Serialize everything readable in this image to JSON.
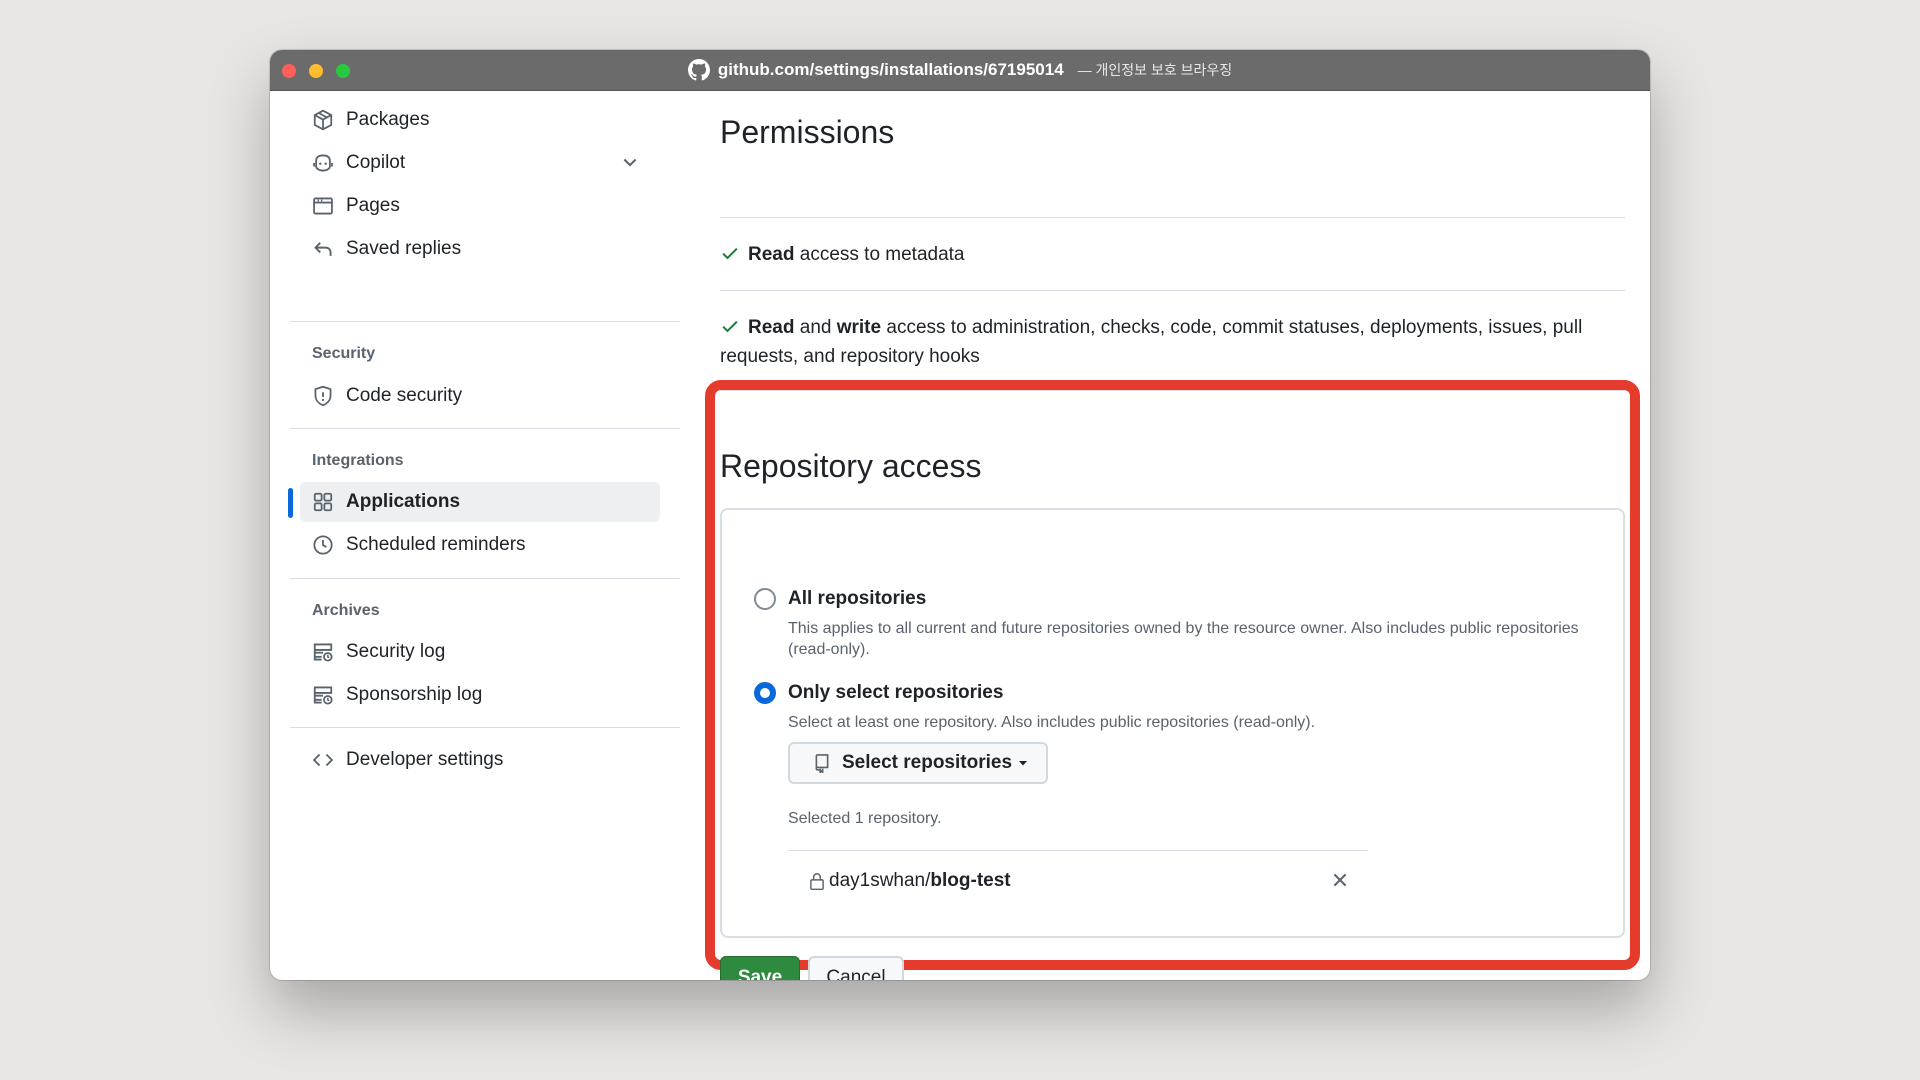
{
  "browser": {
    "url": "github.com/settings/installations/67195014",
    "title_suffix": "— 개인정보 보호 브라우징"
  },
  "sidebar": {
    "items_top": [
      {
        "label": "Packages",
        "icon": "package-icon"
      },
      {
        "label": "Copilot",
        "icon": "copilot-icon",
        "has_chevron": true
      },
      {
        "label": "Pages",
        "icon": "browser-icon"
      },
      {
        "label": "Saved replies",
        "icon": "reply-icon"
      }
    ],
    "security": {
      "title": "Security",
      "items": [
        {
          "label": "Code security",
          "icon": "shield-icon"
        }
      ]
    },
    "integrations": {
      "title": "Integrations",
      "items": [
        {
          "label": "Applications",
          "icon": "apps-icon",
          "active": true
        },
        {
          "label": "Scheduled reminders",
          "icon": "clock-icon"
        }
      ]
    },
    "archives": {
      "title": "Archives",
      "items": [
        {
          "label": "Security log",
          "icon": "log-icon"
        },
        {
          "label": "Sponsorship log",
          "icon": "log-icon"
        }
      ]
    },
    "developer": {
      "label": "Developer settings",
      "icon": "code-icon"
    }
  },
  "permissions": {
    "title": "Permissions",
    "line1": {
      "strong1": "Read",
      "rest": " access to metadata"
    },
    "line2": {
      "strong1": "Read",
      "mid": " and ",
      "strong2": "write",
      "rest": " access to administration, checks, code, commit statuses, deployments, issues, pull requests, and repository hooks"
    }
  },
  "repo_access": {
    "title": "Repository access",
    "all": {
      "label": "All repositories",
      "desc": "This applies to all current and future repositories owned by the resource owner. Also includes public repositories (read-only).",
      "checked": false
    },
    "select": {
      "label": "Only select repositories",
      "desc": "Select at least one repository. Also includes public repositories (read-only).",
      "checked": true
    },
    "select_button": "Select repositories",
    "selected_count": "Selected 1 repository.",
    "repo": {
      "owner": "day1swhan/",
      "name": "blog-test"
    }
  },
  "actions": {
    "save": "Save",
    "cancel": "Cancel"
  },
  "colors": {
    "accent": "#0969da",
    "save": "#2d8a3e",
    "highlight": "#e53b2c"
  }
}
